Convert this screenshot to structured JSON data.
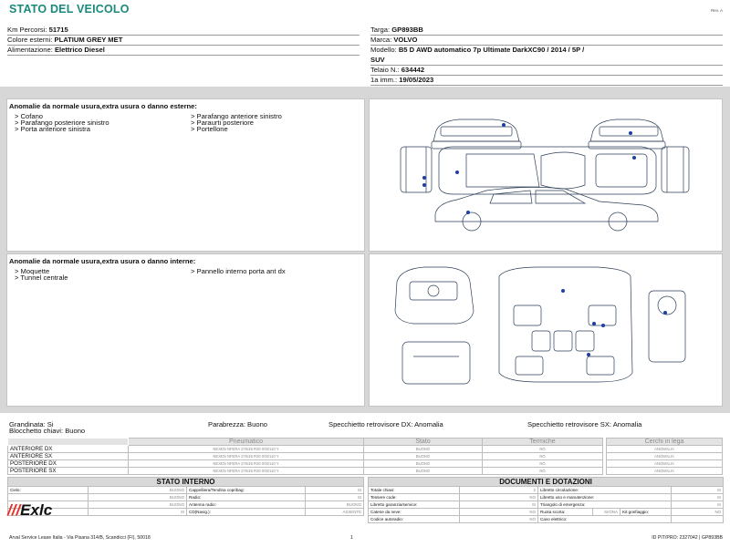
{
  "header": {
    "title": "STATO DEL VEICOLO",
    "rev": "Rev. A"
  },
  "vehicle": {
    "km_label": "Km Percorsi:",
    "km_value": "51715",
    "color_label": "Colore esterni:",
    "color_value": "PLATIUM GREY MET",
    "fuel_label": "Alimentazione:",
    "fuel_value": "Elettrico Diesel",
    "plate_label": "Targa:",
    "plate_value": "GP893BB",
    "brand_label": "Marca:",
    "brand_value": "VOLVO",
    "model_label": "Modello:",
    "model_value_line1": "B5 D AWD automatico 7p Ultimate DarkXC90 / 2014 / 5P /",
    "model_value_line2": "SUV",
    "chassis_label": "Telaio N.:",
    "chassis_value": "634442",
    "reg_label": "1a imm.:",
    "reg_value": "19/05/2023"
  },
  "exterior": {
    "title": "Anomalie da normale usura,extra usura o danno esterne:",
    "left_items": [
      "> Cofano",
      "> Parafango posteriore sinistro",
      "> Porta anteriore sinistra"
    ],
    "right_items": [
      "> Parafango anteriore sinistro",
      "> Paraurti posteriore",
      "> Portellone"
    ]
  },
  "interior": {
    "title": "Anomalie da normale usura,extra usura o danno interne:",
    "left_items": [
      "> Moquette",
      "> Tunnel centrale"
    ],
    "right_items": [
      "> Pannello interno porta ant dx"
    ]
  },
  "status": {
    "hail": "Grandinata: Si",
    "keys": "Blocchetto chiavi: Buono",
    "windshield": "Parabrezza: Buono",
    "mirror_dx": "Specchietto retrovisore DX: Anomalia",
    "mirror_sx": "Specchietto retrovisore SX: Anomalia"
  },
  "tyres": {
    "headers": [
      "Pneumatico",
      "Stato",
      "Termiche",
      "Cerchi in lega"
    ],
    "rows": [
      {
        "pos": "ANTERIORE DX",
        "tyre": "NEXEN NFERA 275/45 R20 000/110 Y",
        "state": "BUONO",
        "winter": "NO",
        "rims": "ANOMALIA"
      },
      {
        "pos": "ANTERIORE SX",
        "tyre": "NEXEN NFERA 275/45 R20 000/110 Y",
        "state": "BUONO",
        "winter": "NO",
        "rims": "ANOMALIA"
      },
      {
        "pos": "POSTERIORE DX",
        "tyre": "NEXEN NFERA 275/45 R20 000/110 Y",
        "state": "BUONO",
        "winter": "NO",
        "rims": "ANOMALIA"
      },
      {
        "pos": "POSTERIORE SX",
        "tyre": "NEXEN NFERA 275/45 R20 000/110 Y",
        "state": "BUONO",
        "winter": "NO",
        "rims": "ANOMALIA"
      }
    ]
  },
  "internal_state": {
    "title": "STATO INTERNO",
    "rows": [
      {
        "l1": "Cielo:",
        "v1": "BUONO",
        "l2": "Cappelliera/Tendina copribag:",
        "v2": "SI"
      },
      {
        "l1": "",
        "v1": "BUONO",
        "l2": "Radio:",
        "v2": "SI"
      },
      {
        "l1": "",
        "v1": "BUONO",
        "l2": "Antenna radio:",
        "v2": "BUONO"
      },
      {
        "l1": "",
        "v1": "SI",
        "l2": "CD(Navig.):",
        "v2": "ASSENTE"
      }
    ]
  },
  "documents": {
    "title": "DOCUMENTI E DOTAZIONI",
    "rows": [
      {
        "l1": "Totale chiavi:",
        "v1": "2",
        "l2": "Libretto circolazione:",
        "v2": "SI"
      },
      {
        "l1": "Tessere code:",
        "v1": "NO",
        "l2": "Libretto uso e manutenzione:",
        "v2": "SI"
      },
      {
        "l1": "Libretto garanzia/service:",
        "v1": "SI",
        "l2": "Triangolo di emergenza:",
        "v2": "SI"
      },
      {
        "l1": "Catene da neve:",
        "v1": "NO",
        "l2": "Ruota scorta:",
        "v2": "SI/ONA",
        "l3": "Kit gonfiaggio:",
        "v3": "NO"
      },
      {
        "l1": "Codice autoradio:",
        "v1": "NO",
        "l2": "Cavo elettrico:",
        "v2": ""
      }
    ]
  },
  "logo": {
    "bars": "///",
    "text": "Exlc"
  },
  "footer": {
    "company": "Arval Service Lease Italia - Via Pisana 314/B, Scandicci (FI), 50018",
    "page": "1",
    "id": "ID PIT/PRO: 2327042 | GP893BB"
  },
  "colors": {
    "title": "#1a8a7a",
    "band": "#d7d7d7",
    "marker": "#1a3fa8",
    "logo_accent": "#e63027"
  }
}
